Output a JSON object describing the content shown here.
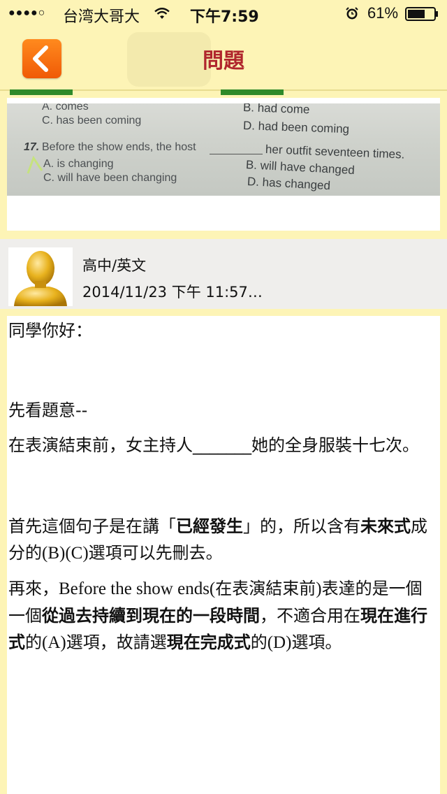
{
  "status_bar": {
    "signal": "●●●●○",
    "carrier": "台湾大哥大",
    "time": "下午7:59",
    "battery": "61%"
  },
  "nav": {
    "title": "問題"
  },
  "question_image": {
    "lines": [
      "A. comes",
      "C. has been coming",
      "17.",
      "Before the show ends, the host",
      "her outfit seventeen times.",
      "A. is changing",
      "C. will have been changing",
      "B. had come",
      "D. had been coming",
      "B. will have changed",
      "D. has changed"
    ]
  },
  "author": {
    "subject": "高中/英文",
    "date": "2014/11/23 下午 11:57…"
  },
  "answer": {
    "greeting": "同學你好：",
    "intro": "先看題意--",
    "translation": "在表演結束前，女主持人_______她的全身服裝十七次。",
    "p1": [
      "首先這個句子是在講「",
      "已經發生",
      "」的，所以含有",
      "未來式",
      "成分的",
      "(B)(C)",
      "選項可以先刪去。"
    ],
    "p2": [
      "再來，",
      "Before the show ends(",
      "在表演結束前",
      ")",
      "表達的是一個一個",
      "從過去持續到現在的一段時間",
      "，不適合用在",
      "現在進行式",
      "的",
      "(A)",
      "選項，故請選",
      "現在完成式",
      "的",
      "(D)",
      "選項。"
    ]
  },
  "colors": {
    "background": "#fdf4b6",
    "title": "#b0262d",
    "back_button": "#f26a0a",
    "tab_indicator": "#2f8a2a"
  }
}
